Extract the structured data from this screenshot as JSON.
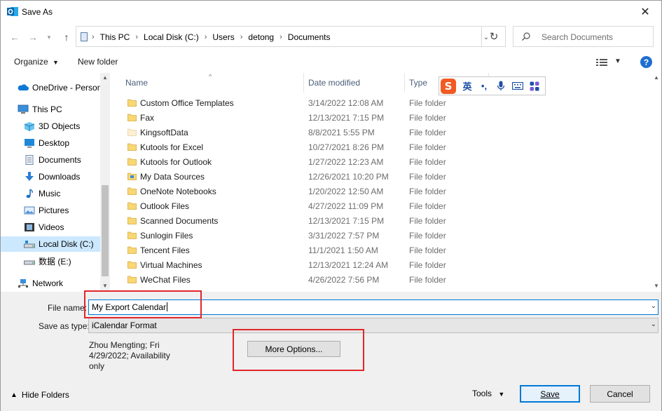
{
  "window": {
    "title": "Save As",
    "close_symbol": "✕",
    "app_icon": "outlook-icon"
  },
  "address": {
    "crumbs": [
      "This PC",
      "Local Disk (C:)",
      "Users",
      "detong",
      "Documents"
    ],
    "search_placeholder": "Search Documents"
  },
  "toolbar": {
    "organize_label": "Organize",
    "new_folder_label": "New folder",
    "help_label": "?"
  },
  "nav": {
    "items": [
      {
        "label": "OneDrive - Person",
        "icon": "onedrive-cloud-icon"
      },
      {
        "label": "This PC",
        "icon": "computer-icon"
      },
      {
        "label": "3D Objects",
        "icon": "3d-objects-icon"
      },
      {
        "label": "Desktop",
        "icon": "desktop-icon"
      },
      {
        "label": "Documents",
        "icon": "documents-icon"
      },
      {
        "label": "Downloads",
        "icon": "downloads-icon"
      },
      {
        "label": "Music",
        "icon": "music-icon"
      },
      {
        "label": "Pictures",
        "icon": "pictures-icon"
      },
      {
        "label": "Videos",
        "icon": "videos-icon"
      },
      {
        "label": "Local Disk (C:)",
        "icon": "drive-icon"
      },
      {
        "label": "数据 (E:)",
        "icon": "drive-icon"
      },
      {
        "label": "Network",
        "icon": "network-icon"
      }
    ],
    "selected": "Local Disk (C:)"
  },
  "columns": {
    "name": "Name",
    "date": "Date modified",
    "type": "Type"
  },
  "files": [
    {
      "name": "Custom Office Templates",
      "date": "3/14/2022 12:08 AM",
      "type": "File folder"
    },
    {
      "name": "Fax",
      "date": "12/13/2021 7:15 PM",
      "type": "File folder"
    },
    {
      "name": "KingsoftData",
      "date": "8/8/2021 5:55 PM",
      "type": "File folder"
    },
    {
      "name": "Kutools for Excel",
      "date": "10/27/2021 8:26 PM",
      "type": "File folder"
    },
    {
      "name": "Kutools for Outlook",
      "date": "1/27/2022 12:23 AM",
      "type": "File folder"
    },
    {
      "name": "My Data Sources",
      "date": "12/26/2021 10:20 PM",
      "type": "File folder"
    },
    {
      "name": "OneNote Notebooks",
      "date": "1/20/2022 12:50 AM",
      "type": "File folder"
    },
    {
      "name": "Outlook Files",
      "date": "4/27/2022 11:09 PM",
      "type": "File folder"
    },
    {
      "name": "Scanned Documents",
      "date": "12/13/2021 7:15 PM",
      "type": "File folder"
    },
    {
      "name": "Sunlogin Files",
      "date": "3/31/2022 7:57 PM",
      "type": "File folder"
    },
    {
      "name": "Tencent Files",
      "date": "11/1/2021 1:50 AM",
      "type": "File folder"
    },
    {
      "name": "Virtual Machines",
      "date": "12/13/2021 12:24 AM",
      "type": "File folder"
    },
    {
      "name": "WeChat Files",
      "date": "4/26/2022 7:56 PM",
      "type": "File folder"
    }
  ],
  "ime": {
    "logo": "S",
    "lang": "英",
    "punct": "•,",
    "icons": [
      "microphone-icon",
      "keyboard-icon",
      "toolbox-icon"
    ]
  },
  "form": {
    "file_name_label": "File name:",
    "file_name_value": "My Export Calendar",
    "save_type_label": "Save as type:",
    "save_type_value": "iCalendar Format",
    "author_text": "Zhou Mengting; Fri 4/29/2022; Availability only",
    "more_options_label": "More Options..."
  },
  "footer": {
    "hide_folders_label": "Hide Folders",
    "tools_label": "Tools",
    "save_label": "Save",
    "cancel_label": "Cancel"
  },
  "colors": {
    "accent": "#0078d7",
    "selection": "#cce8ff",
    "highlight_red": "#e0262b",
    "folder_yellow": "#f8d775",
    "ime_orange": "#f15a22"
  }
}
